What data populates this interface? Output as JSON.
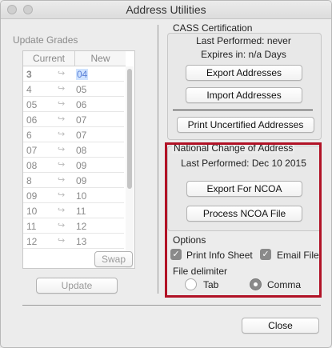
{
  "window": {
    "title": "Address Utilities"
  },
  "update_grades": {
    "label": "Update Grades",
    "columns": [
      "Current",
      "New"
    ],
    "rows": [
      {
        "current": "3",
        "new": "04"
      },
      {
        "current": "4",
        "new": "05"
      },
      {
        "current": "05",
        "new": "06"
      },
      {
        "current": "06",
        "new": "07"
      },
      {
        "current": "6",
        "new": "07"
      },
      {
        "current": "07",
        "new": "08"
      },
      {
        "current": "08",
        "new": "09"
      },
      {
        "current": "8",
        "new": "09"
      },
      {
        "current": "09",
        "new": "10"
      },
      {
        "current": "10",
        "new": "11"
      },
      {
        "current": "11",
        "new": "12"
      },
      {
        "current": "12",
        "new": "13"
      }
    ],
    "swap_label": "Swap",
    "update_label": "Update"
  },
  "cass": {
    "label": "CASS Certification",
    "last_performed": "Last Performed: never",
    "expires": "Expires in: n/a Days",
    "export_label": "Export Addresses",
    "import_label": "Import Addresses",
    "print_label": "Print Uncertified Addresses"
  },
  "ncoa": {
    "label": "National Change of Address",
    "last_performed": "Last Performed: Dec 10 2015",
    "export_label": "Export For NCOA",
    "process_label": "Process NCOA File",
    "options_label": "Options",
    "print_info_sheet": "Print Info Sheet",
    "email_file": "Email File",
    "file_delimiter_label": "File delimiter",
    "tab_label": "Tab",
    "comma_label": "Comma",
    "print_info_sheet_checked": true,
    "email_file_checked": true,
    "selected_delimiter": "Comma"
  },
  "footer": {
    "close_label": "Close"
  },
  "colors": {
    "highlight": "#b11226",
    "background": "#ececec"
  }
}
